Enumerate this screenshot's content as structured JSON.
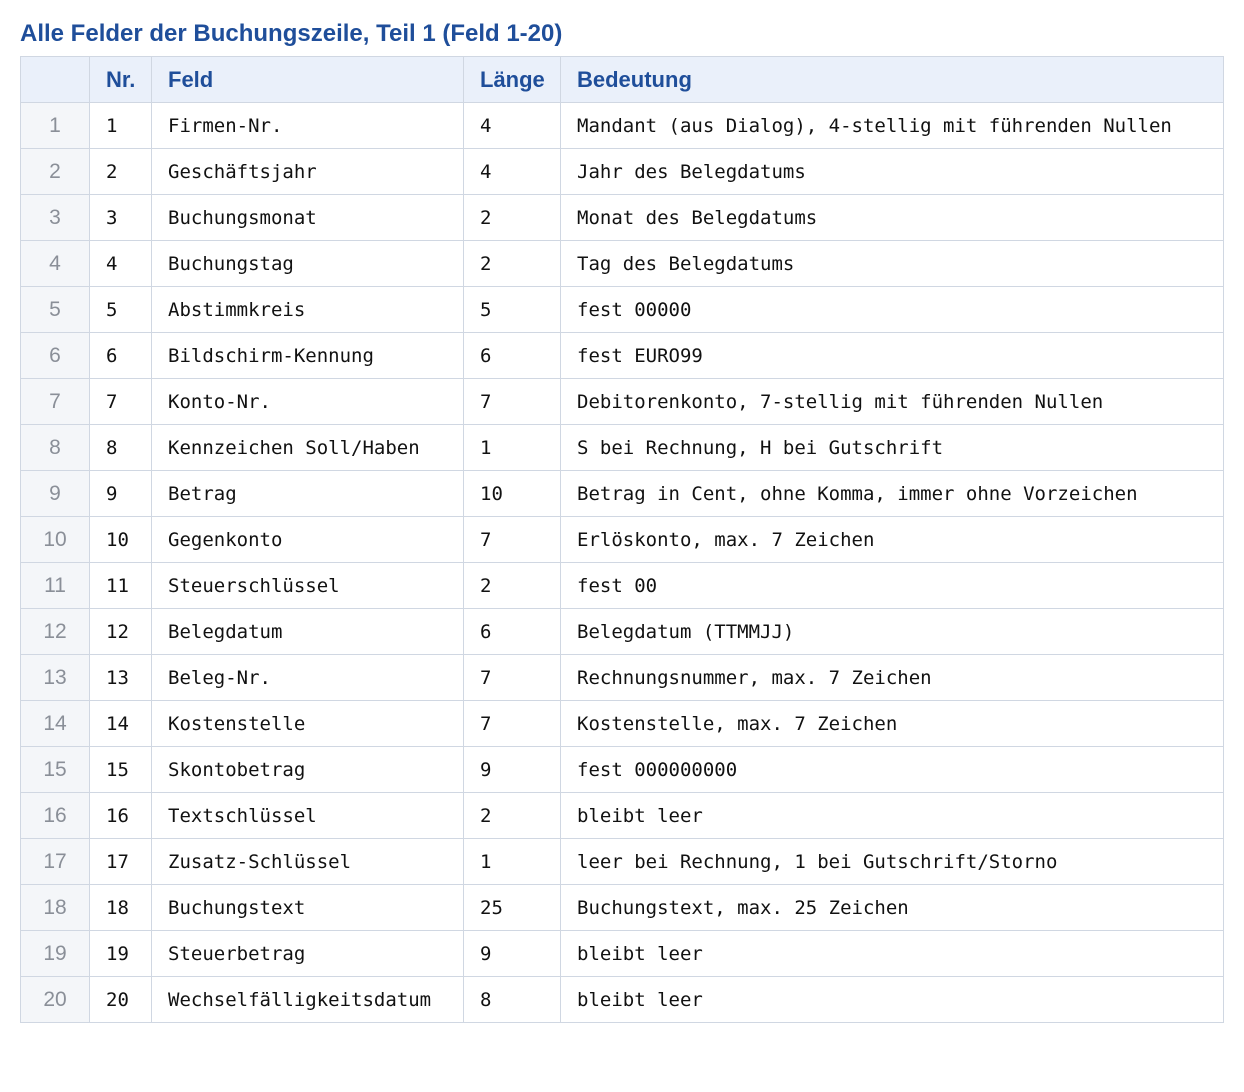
{
  "title": "Alle Felder der Buchungszeile, Teil 1 (Feld 1-20)",
  "table": {
    "headers": {
      "index": "",
      "nr": "Nr.",
      "feld": "Feld",
      "laenge": "Länge",
      "bedeutung": "Bedeutung"
    },
    "rows": [
      {
        "index": "1",
        "nr": "1",
        "feld": "Firmen-Nr.",
        "laenge": "4",
        "bedeutung": "Mandant (aus Dialog), 4-stellig mit führenden Nullen"
      },
      {
        "index": "2",
        "nr": "2",
        "feld": "Geschäftsjahr",
        "laenge": "4",
        "bedeutung": "Jahr des Belegdatums"
      },
      {
        "index": "3",
        "nr": "3",
        "feld": "Buchungsmonat",
        "laenge": "2",
        "bedeutung": "Monat des Belegdatums"
      },
      {
        "index": "4",
        "nr": "4",
        "feld": "Buchungstag",
        "laenge": "2",
        "bedeutung": "Tag des Belegdatums"
      },
      {
        "index": "5",
        "nr": "5",
        "feld": "Abstimmkreis",
        "laenge": "5",
        "bedeutung": "fest 00000"
      },
      {
        "index": "6",
        "nr": "6",
        "feld": "Bildschirm-Kennung",
        "laenge": "6",
        "bedeutung": "fest EURO99"
      },
      {
        "index": "7",
        "nr": "7",
        "feld": "Konto-Nr.",
        "laenge": "7",
        "bedeutung": "Debitorenkonto, 7-stellig mit führenden Nullen"
      },
      {
        "index": "8",
        "nr": "8",
        "feld": "Kennzeichen Soll/Haben",
        "laenge": "1",
        "bedeutung": "S bei Rechnung, H bei Gutschrift"
      },
      {
        "index": "9",
        "nr": "9",
        "feld": "Betrag",
        "laenge": "10",
        "bedeutung": "Betrag in Cent, ohne Komma, immer ohne Vorzeichen"
      },
      {
        "index": "10",
        "nr": "10",
        "feld": "Gegenkonto",
        "laenge": "7",
        "bedeutung": "Erlöskonto, max. 7 Zeichen"
      },
      {
        "index": "11",
        "nr": "11",
        "feld": "Steuerschlüssel",
        "laenge": "2",
        "bedeutung": "fest 00"
      },
      {
        "index": "12",
        "nr": "12",
        "feld": "Belegdatum",
        "laenge": "6",
        "bedeutung": "Belegdatum (TTMMJJ)"
      },
      {
        "index": "13",
        "nr": "13",
        "feld": "Beleg-Nr.",
        "laenge": "7",
        "bedeutung": "Rechnungsnummer, max. 7 Zeichen"
      },
      {
        "index": "14",
        "nr": "14",
        "feld": "Kostenstelle",
        "laenge": "7",
        "bedeutung": "Kostenstelle, max. 7 Zeichen"
      },
      {
        "index": "15",
        "nr": "15",
        "feld": "Skontobetrag",
        "laenge": "9",
        "bedeutung": "fest 000000000"
      },
      {
        "index": "16",
        "nr": "16",
        "feld": "Textschlüssel",
        "laenge": "2",
        "bedeutung": "bleibt leer"
      },
      {
        "index": "17",
        "nr": "17",
        "feld": "Zusatz-Schlüssel",
        "laenge": "1",
        "bedeutung": "leer bei Rechnung, 1 bei Gutschrift/Storno"
      },
      {
        "index": "18",
        "nr": "18",
        "feld": "Buchungstext",
        "laenge": "25",
        "bedeutung": "Buchungstext, max. 25 Zeichen"
      },
      {
        "index": "19",
        "nr": "19",
        "feld": "Steuerbetrag",
        "laenge": "9",
        "bedeutung": "bleibt leer"
      },
      {
        "index": "20",
        "nr": "20",
        "feld": "Wechselfälligkeitsdatum",
        "laenge": "8",
        "bedeutung": "bleibt leer"
      }
    ]
  }
}
